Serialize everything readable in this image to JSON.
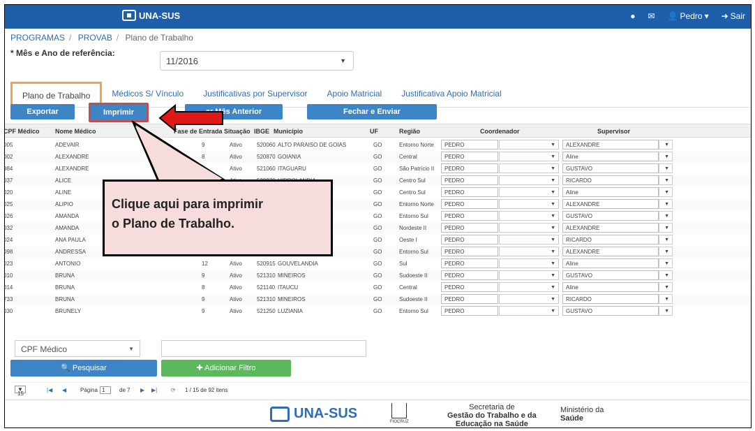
{
  "header": {
    "logo": "UNA-SUS",
    "help_icon": "?",
    "mail_icon": "mail-icon",
    "user": "Pedro",
    "logout": "Sair"
  },
  "breadcrumb": {
    "programas": "PROGRAMAS",
    "provab": "PROVAB",
    "current": "Plano de Trabalho"
  },
  "form": {
    "label": "Mês e Ano de referência:",
    "value": "11/2016"
  },
  "tabs": [
    "Plano de Trabalho",
    "Médicos S/ Vínculo",
    "Justificativas por Supervisor",
    "Apoio Matricial",
    "Justificativa Apoio Matricial"
  ],
  "toolbar": {
    "exportar": "Exportar",
    "imprimir": "Imprimir",
    "copiar": "ar Mês Anterior",
    "fechar": "Fechar e Enviar"
  },
  "table": {
    "headers": [
      "CPF Médico",
      "Nome Médico",
      "Fase de Entrada",
      "Situação",
      "IBGE",
      "Município",
      "UF",
      "Região",
      "Coordenador",
      "Supervisor"
    ],
    "rows": [
      {
        "cpf": "005",
        "nome": "ADEVAIR",
        "fase": "9",
        "sit": "Ativo",
        "ibge": "520060",
        "mun": "ALTO PARAISO DE GOIAS",
        "uf": "GO",
        "reg": "Entorno Norte",
        "coord": "PEDRO",
        "sup": "ALEXANDRE"
      },
      {
        "cpf": "002",
        "nome": "ALEXANDRE",
        "fase": "8",
        "sit": "Ativo",
        "ibge": "520870",
        "mun": "GOIANIA",
        "uf": "GO",
        "reg": "Central",
        "coord": "PEDRO",
        "sup": "Aline"
      },
      {
        "cpf": "984",
        "nome": "ALEXANDRE",
        "fase": "8",
        "sit": "Ativo",
        "ibge": "521060",
        "mun": "ITAGUARU",
        "uf": "GO",
        "reg": "São Patrício II",
        "coord": "PEDRO",
        "sup": "GUSTAVO"
      },
      {
        "cpf": "037",
        "nome": "ALICE",
        "fase": "10",
        "sit": "Ativo",
        "ibge": "520970",
        "mun": "HIDROLANDIA",
        "uf": "GO",
        "reg": "Centro Sul",
        "coord": "PEDRO",
        "sup": "RICARDO"
      },
      {
        "cpf": "020",
        "nome": "ALINE",
        "fase": "",
        "sit": "",
        "ibge": "",
        "mun": "O",
        "uf": "GO",
        "reg": "Centro Sul",
        "coord": "PEDRO",
        "sup": "Aline"
      },
      {
        "cpf": "025",
        "nome": "ALIPIO",
        "fase": "",
        "sit": "",
        "ibge": "",
        "mun": "",
        "uf": "GO",
        "reg": "Entorno Norte",
        "coord": "PEDRO",
        "sup": "ALEXANDRE"
      },
      {
        "cpf": "026",
        "nome": "AMANDA",
        "fase": "",
        "sit": "",
        "ibge": "",
        "mun": "DO DESCOBE",
        "uf": "GO",
        "reg": "Entorno Sul",
        "coord": "PEDRO",
        "sup": "GUSTAVO"
      },
      {
        "cpf": "032",
        "nome": "AMANDA",
        "fase": "",
        "sit": "",
        "ibge": "",
        "mun": "",
        "uf": "GO",
        "reg": "Nordeste II",
        "coord": "PEDRO",
        "sup": "ALEXANDRE"
      },
      {
        "cpf": "024",
        "nome": "ANA PAULA",
        "fase": "",
        "sit": "",
        "ibge": "",
        "mun": "",
        "uf": "GO",
        "reg": "Oeste I",
        "coord": "PEDRO",
        "sup": "RICARDO"
      },
      {
        "cpf": "098",
        "nome": "ANDRESSA",
        "fase": "9",
        "sit": "Ativo",
        "ibge": "520620",
        "mun": "CRISTALINA",
        "uf": "GO",
        "reg": "Entorno Sul",
        "coord": "PEDRO",
        "sup": "ALEXANDRE"
      },
      {
        "cpf": "023",
        "nome": "ANTONIO",
        "fase": "12",
        "sit": "Ativo",
        "ibge": "520915",
        "mun": "GOUVELANDIA",
        "uf": "GO",
        "reg": "Sul",
        "coord": "PEDRO",
        "sup": "Aline"
      },
      {
        "cpf": "010",
        "nome": "BRUNA",
        "fase": "9",
        "sit": "Ativo",
        "ibge": "521310",
        "mun": "MINEIROS",
        "uf": "GO",
        "reg": "Sudoeste II",
        "coord": "PEDRO",
        "sup": "GUSTAVO"
      },
      {
        "cpf": "014",
        "nome": "BRUNA",
        "fase": "8",
        "sit": "Ativo",
        "ibge": "521140",
        "mun": "ITAUCU",
        "uf": "GO",
        "reg": "Central",
        "coord": "PEDRO",
        "sup": "Aline"
      },
      {
        "cpf": "733",
        "nome": "BRUNA",
        "fase": "9",
        "sit": "Ativo",
        "ibge": "521310",
        "mun": "MINEIROS",
        "uf": "GO",
        "reg": "Sudoeste II",
        "coord": "PEDRO",
        "sup": "RICARDO"
      },
      {
        "cpf": "030",
        "nome": "BRUNELY",
        "fase": "9",
        "sit": "Ativo",
        "ibge": "521250",
        "mun": "LUZIANIA",
        "uf": "GO",
        "reg": "Entorno Sul",
        "coord": "PEDRO",
        "sup": "GUSTAVO"
      }
    ]
  },
  "filter": {
    "field": "CPF Médico",
    "search": "Pesquisar",
    "add": "Adicionar Filtro"
  },
  "pager": {
    "size": "15",
    "page_label": "Página",
    "page": "1",
    "of": "de 7",
    "items": "1 / 15 de 92 itens"
  },
  "callout": {
    "line1": "Clique aqui para imprimir",
    "line2": "o Plano de Trabalho."
  },
  "footer": {
    "logo": "UNA-SUS",
    "fiocruz": "FIOCRUZ",
    "sec1": "Secretaria de",
    "sec2": "Gestão do Trabalho e da",
    "sec3": "Educação na Saúde",
    "min1": "Ministério da",
    "min2": "Saúde"
  },
  "colors": {
    "topbar": "#1f5ea8",
    "button": "#3d85c6",
    "green": "#5cb85c",
    "callout": "#f6dcdd",
    "arrow": "#e01818"
  }
}
